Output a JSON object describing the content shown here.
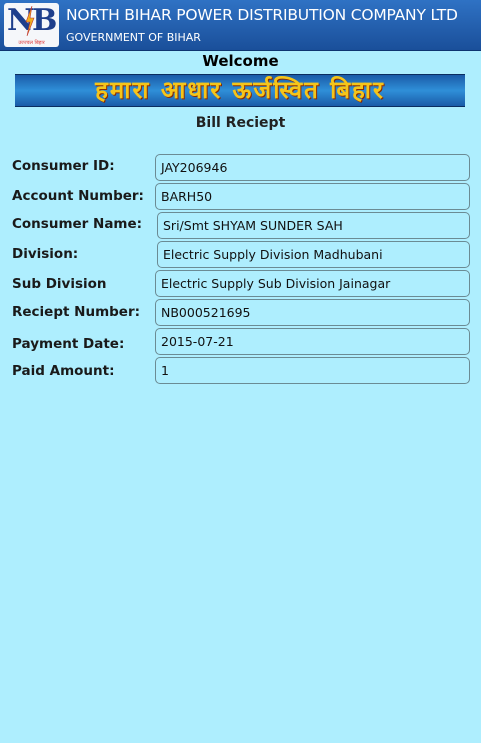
{
  "header": {
    "logo_letters": "NB",
    "logo_tagline": "उज्ज्वल बिहार",
    "company_name": "NORTH BIHAR POWER DISTRIBUTION COMPANY LTD",
    "government": "GOVERNMENT OF BIHAR",
    "background_color": "#2060b0"
  },
  "welcome": "Welcome",
  "banner": {
    "text": "हमारा आधार ऊर्जस्वित बिहार",
    "text_color": "#f5c51a"
  },
  "receipt": {
    "title": "Bill Reciept",
    "fields": [
      {
        "label": "Consumer ID:",
        "value": "JAY206946"
      },
      {
        "label": "Account Number:",
        "value": "BARH50"
      },
      {
        "label": "Consumer Name:",
        "value": "Sri/Smt SHYAM SUNDER SAH"
      },
      {
        "label": "Division:",
        "value": "Electric Supply Division Madhubani"
      },
      {
        "label": "Sub Division",
        "value": "Electric Supply Sub Division Jainagar"
      },
      {
        "label": "Reciept Number:",
        "value": "NB000521695"
      },
      {
        "label": "Payment Date:",
        "value": "2015-07-21"
      },
      {
        "label": "Paid Amount:",
        "value": "1"
      }
    ]
  },
  "page_background": "#aeeefe"
}
